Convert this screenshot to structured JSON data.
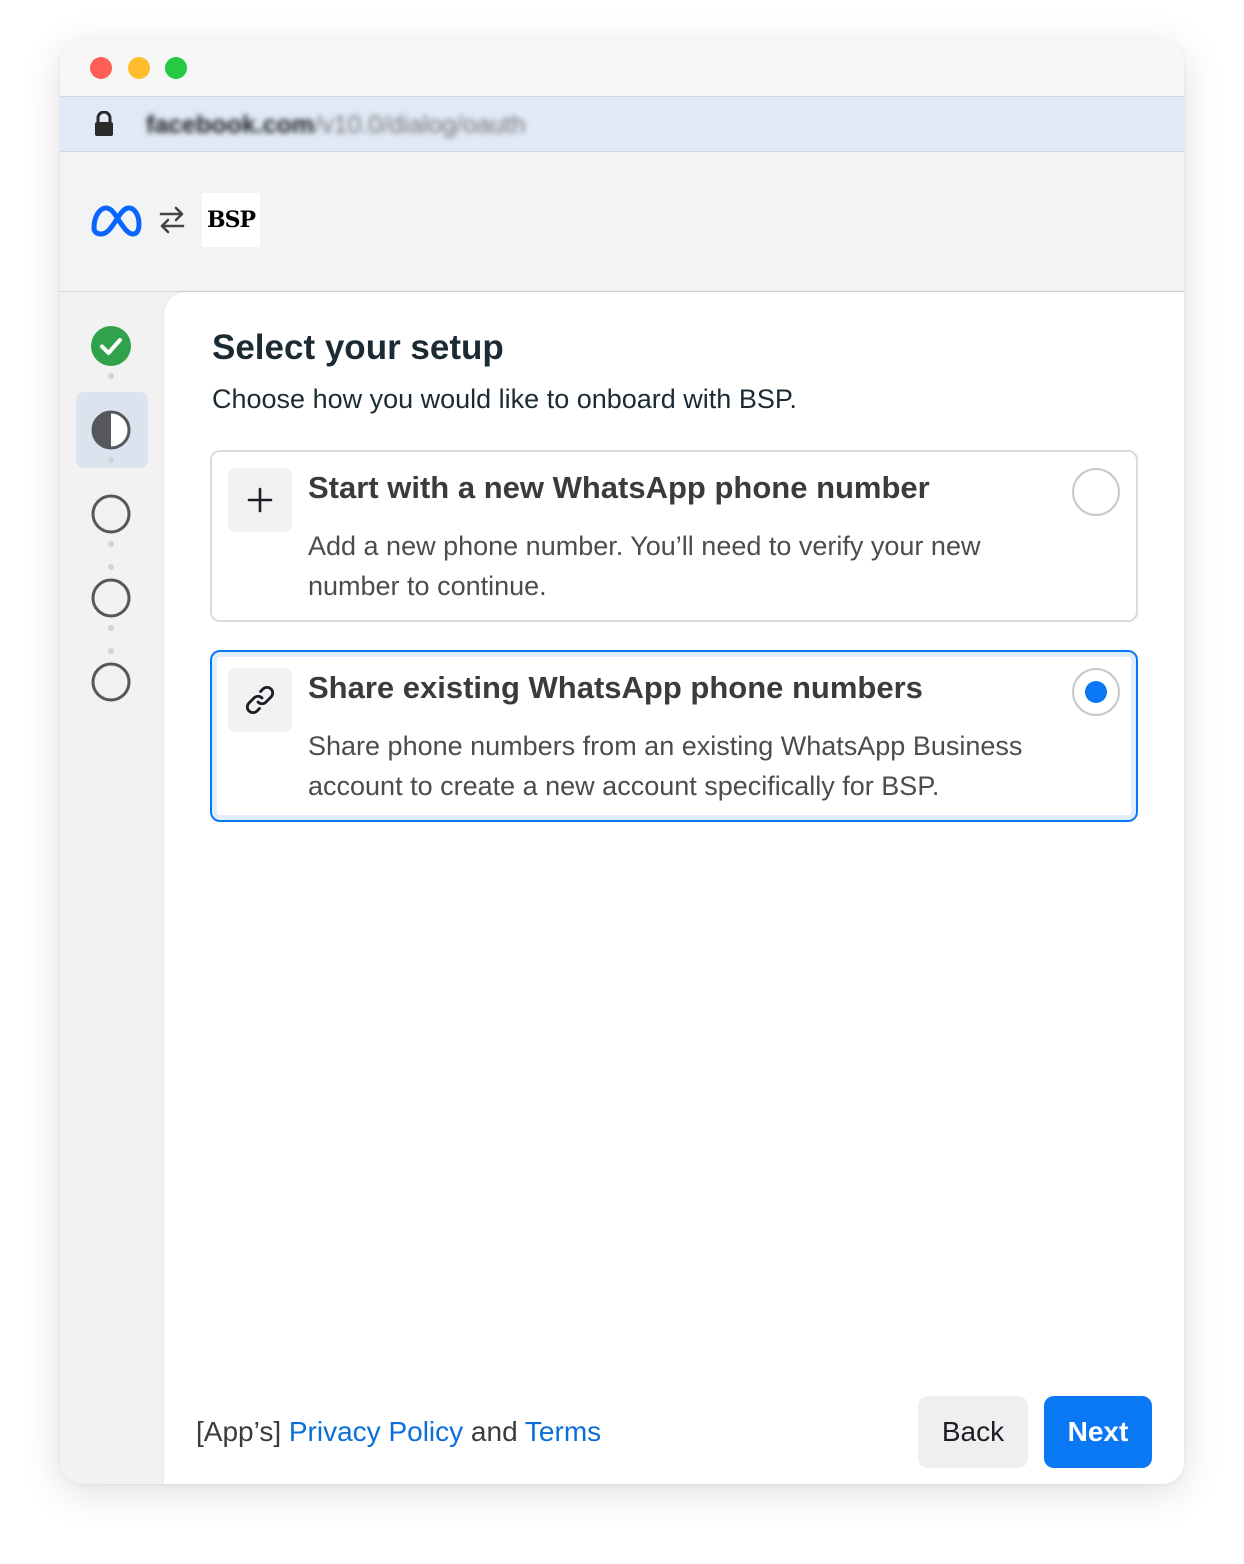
{
  "browser": {
    "url_domain": "facebook.com",
    "url_path": "/v10.0/dialog/oauth"
  },
  "header": {
    "logo_left": "meta-logo",
    "swap": "swap-icon",
    "partner_logo_text": "BSP"
  },
  "stepper": {
    "steps": [
      {
        "state": "completed"
      },
      {
        "state": "current"
      },
      {
        "state": "upcoming"
      },
      {
        "state": "upcoming"
      },
      {
        "state": "upcoming"
      }
    ]
  },
  "main": {
    "title": "Select your setup",
    "subtitle": "Choose how you would like to onboard with BSP.",
    "options": [
      {
        "icon": "plus-icon",
        "title": "Start with a new WhatsApp phone number",
        "description": "Add a new phone number. You’ll need to verify your new number to continue.",
        "selected": false
      },
      {
        "icon": "link-icon",
        "title": "Share existing WhatsApp phone numbers",
        "description": "Share phone numbers from an existing WhatsApp Business account to create a new account specifically for BSP.",
        "selected": true
      }
    ]
  },
  "footer": {
    "prefix": "[App’s]",
    "privacy_link": "Privacy Policy",
    "and": "and",
    "terms_link": "Terms",
    "back_label": "Back",
    "next_label": "Next"
  },
  "colors": {
    "accent": "#0a78f5",
    "success": "#31a24c",
    "link": "#0a6edb"
  }
}
